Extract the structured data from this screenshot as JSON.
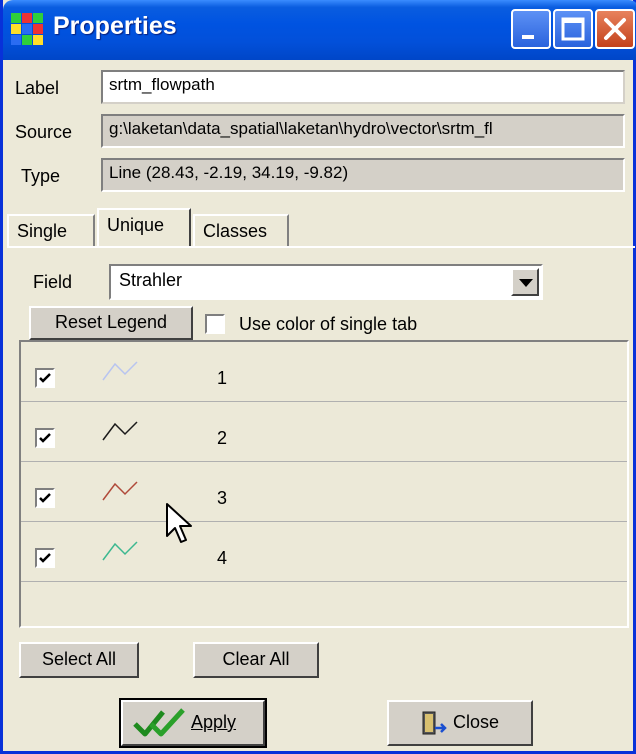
{
  "window": {
    "title": "Properties"
  },
  "form": {
    "label_caption": "Label",
    "label_value": "srtm_flowpath",
    "source_caption": "Source",
    "source_value": "g:\\laketan\\data_spatial\\laketan\\hydro\\vector\\srtm_fl",
    "type_caption": "Type",
    "type_value": "Line   (28.43, -2.19, 34.19, -9.82)"
  },
  "tabs": [
    {
      "label": "Single"
    },
    {
      "label": "Unique"
    },
    {
      "label": "Classes"
    }
  ],
  "unique": {
    "field_caption": "Field",
    "field_value": "Strahler",
    "reset_label": "Reset Legend",
    "use_color_label": "Use color of single tab",
    "rows": [
      {
        "checked": true,
        "value": "1",
        "color": "#b8c4f0"
      },
      {
        "checked": true,
        "value": "2",
        "color": "#1a1a1a"
      },
      {
        "checked": true,
        "value": "3",
        "color": "#b04a3a"
      },
      {
        "checked": true,
        "value": "4",
        "color": "#3cb890"
      }
    ],
    "select_all_label": "Select All",
    "clear_all_label": "Clear All"
  },
  "footer": {
    "apply_label": "Apply",
    "close_label": "Close",
    "apply_icon": "double-check-icon",
    "close_icon": "door-exit-icon"
  }
}
